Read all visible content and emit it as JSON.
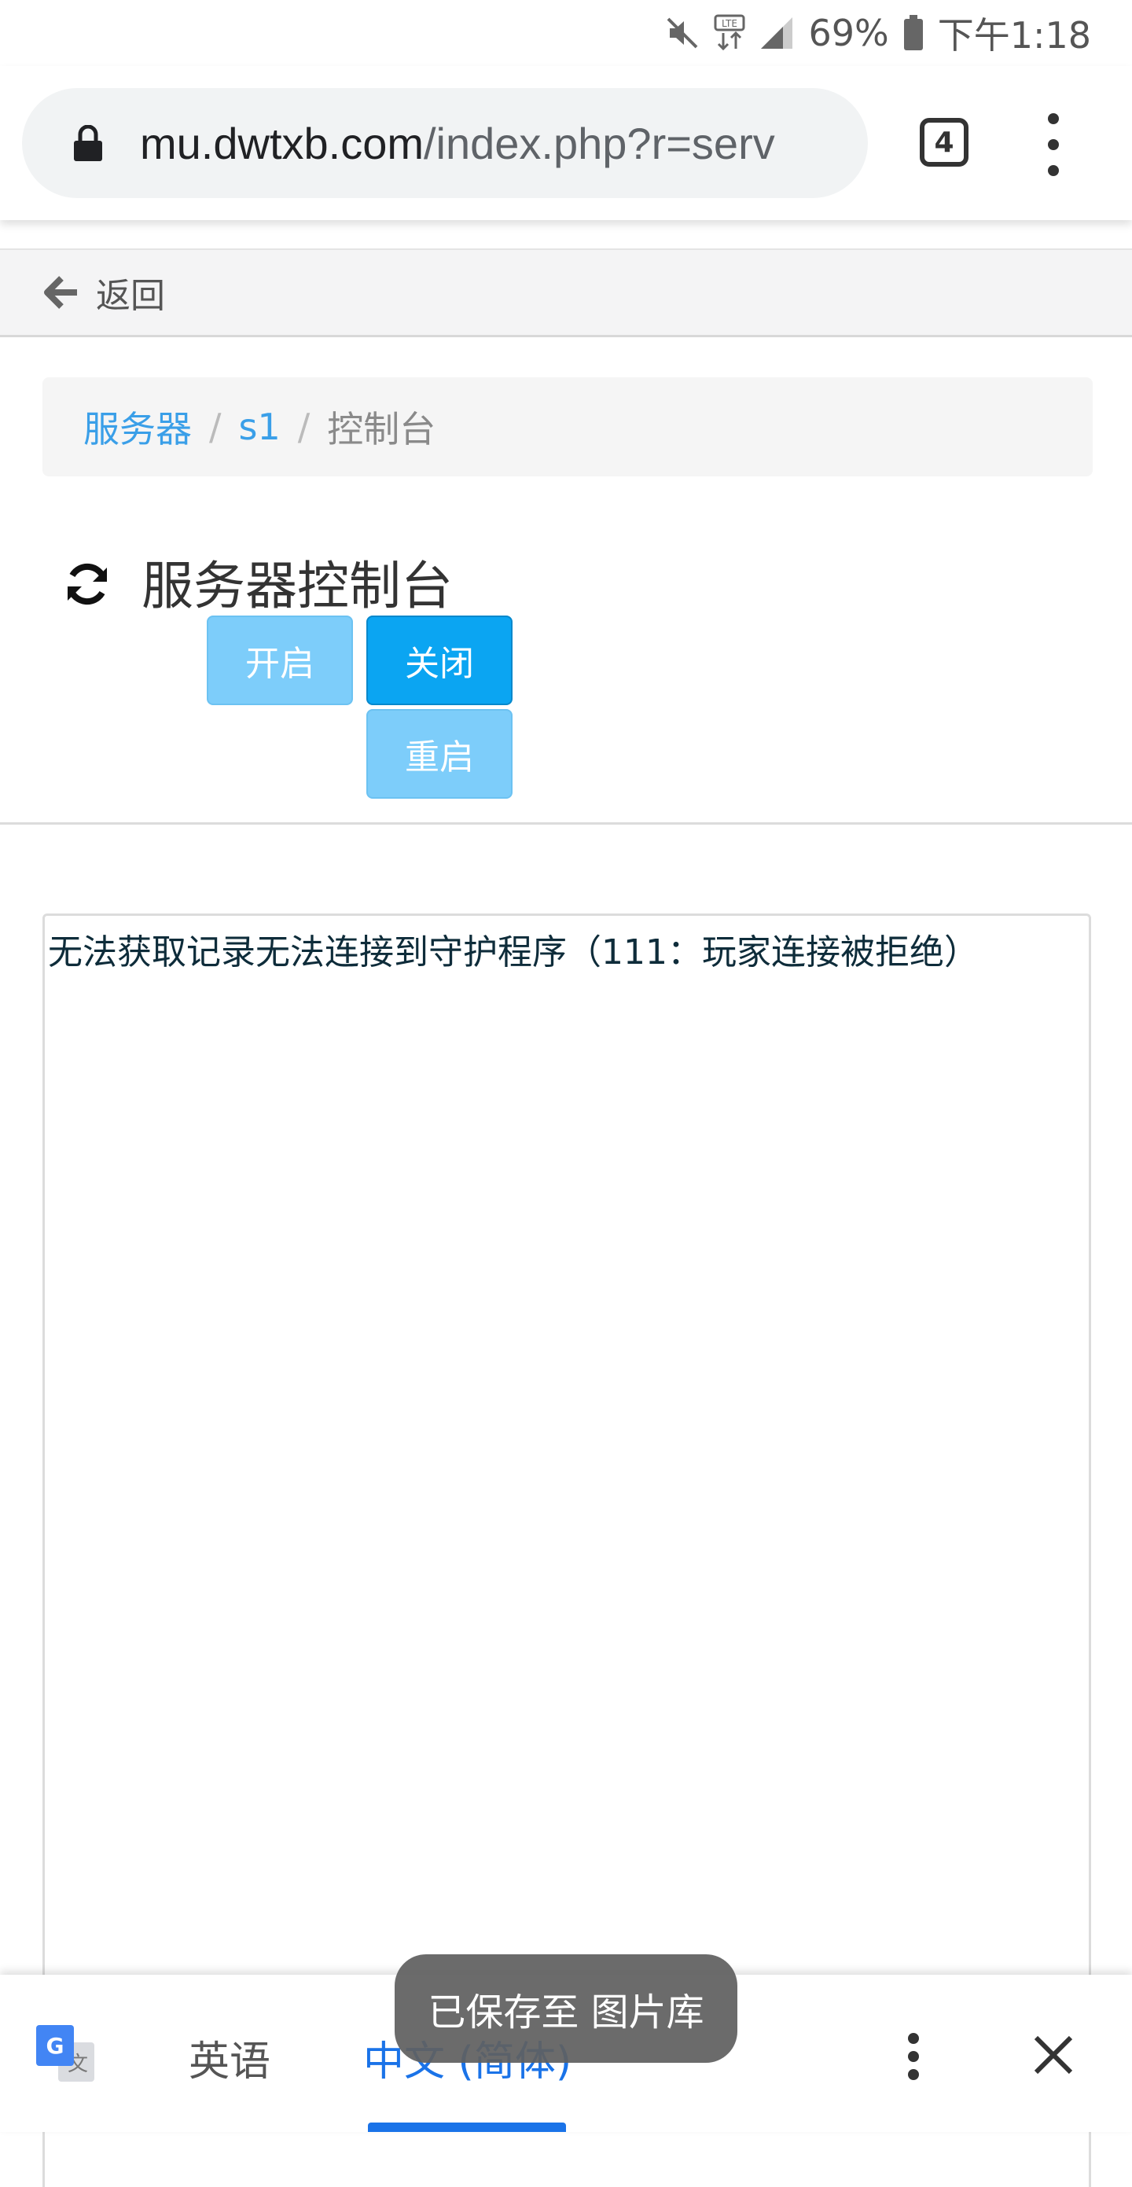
{
  "status_bar": {
    "battery_percent": "69%",
    "time": "下午1:18",
    "icons": [
      "mute-icon",
      "lte-icon",
      "signal-icon",
      "battery-icon"
    ]
  },
  "browser": {
    "url_host": "mu.dwtxb.com",
    "url_path": "/index.php?r=serv",
    "tab_count": "4"
  },
  "nav": {
    "back_label": "返回"
  },
  "breadcrumb": {
    "items": [
      "服务器",
      "s1",
      "控制台"
    ],
    "separator": "/"
  },
  "page": {
    "title": "服务器控制台"
  },
  "controls": {
    "start_label": "开启",
    "stop_label": "关闭",
    "restart_label": "重启"
  },
  "console": {
    "output": "无法获取记录无法连接到守护程序（111：玩家连接被拒绝）"
  },
  "translate_bar": {
    "source_language": "英语",
    "target_language": "中文 (简体)"
  },
  "toast": {
    "message": "已保存至 图片库"
  },
  "colors": {
    "link": "#3a9fe8",
    "primary_button": "#0ba5f2",
    "light_button": "#7dcdfa",
    "translate_accent": "#1a73e8"
  }
}
